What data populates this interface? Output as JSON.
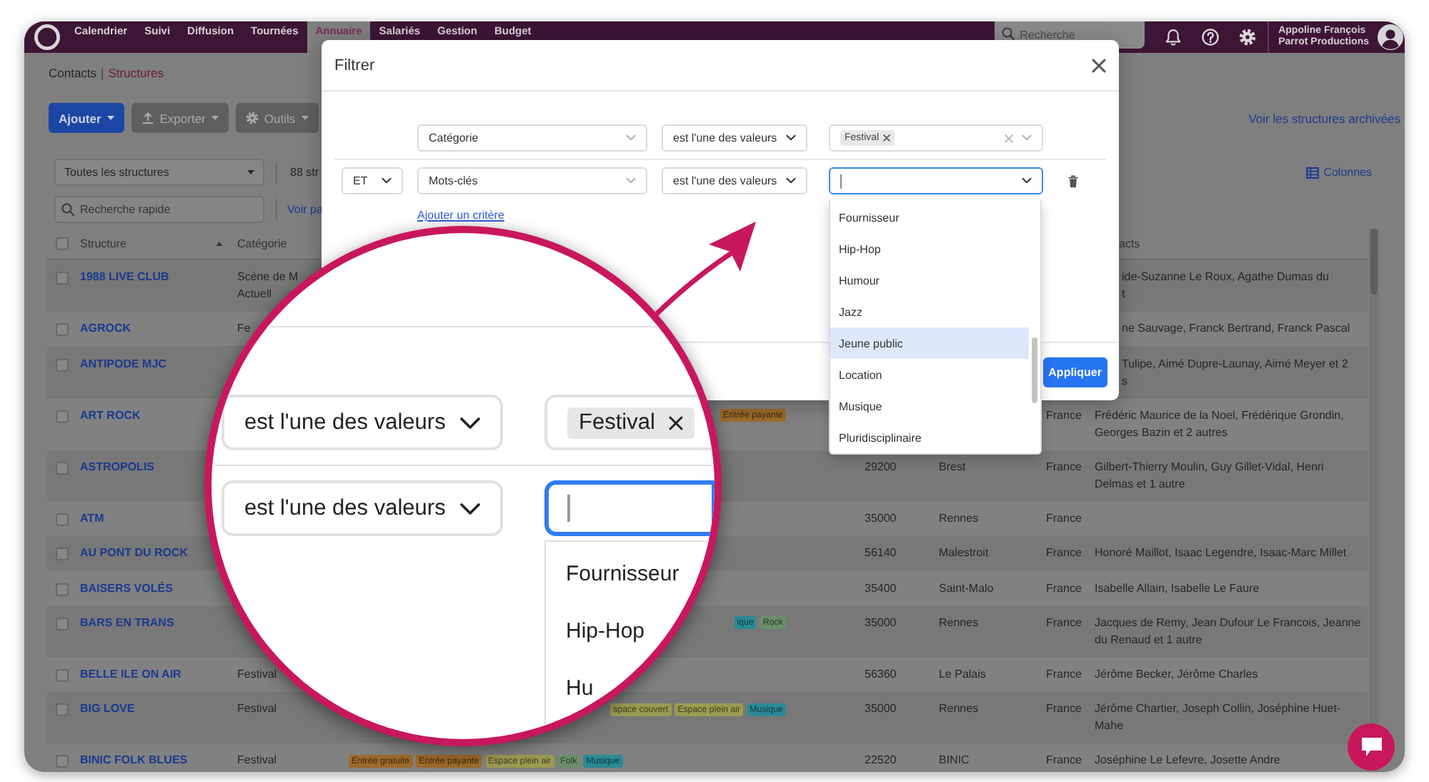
{
  "nav": {
    "items": [
      {
        "label": "Calendrier",
        "selected": false
      },
      {
        "label": "Suivi",
        "selected": false
      },
      {
        "label": "Diffusion",
        "selected": false
      },
      {
        "label": "Tournées",
        "selected": false
      },
      {
        "label": "Annuaire",
        "selected": true
      },
      {
        "label": "Salariés",
        "selected": false
      },
      {
        "label": "Gestion",
        "selected": false
      },
      {
        "label": "Budget",
        "selected": false
      }
    ],
    "search": {
      "placeholder": "Recherche"
    },
    "user": {
      "name": "Appoline François",
      "company": "Parrot Productions"
    }
  },
  "breadcrumb": {
    "parent": "Contacts",
    "separator": "|",
    "current": "Structures"
  },
  "toolbar": {
    "buttons": [
      {
        "label": "Ajouter",
        "kind": "primary"
      },
      {
        "label": "Exporter",
        "kind": "export"
      },
      {
        "label": "Outils",
        "kind": "tools"
      }
    ],
    "archived_link": "Voir les structures archivées"
  },
  "filters": {
    "scope": "Toutes les structures",
    "count": "88 str",
    "columns_link": "Colonnes",
    "quick_search": {
      "placeholder": "Recherche rapide"
    },
    "view_link": "Voir pa"
  },
  "table": {
    "select_all": {
      "checked": false
    },
    "columns": [
      {
        "label": "Structure",
        "sort_ascending": true
      },
      {
        "label": "Catégorie"
      },
      {
        "label": "acts"
      }
    ],
    "rows": [
      {
        "checked": false,
        "name": "1988 LIVE CLUB",
        "category": "Scène de M\nActuell",
        "contacts": "ide-Suzanne Le Roux, Agathe Dumas du\nt"
      },
      {
        "checked": false,
        "name": "AGROCK",
        "category": "Fe",
        "contacts": "ne Sauvage, Franck Bertrand, Franck Pascal"
      },
      {
        "checked": false,
        "name": "ANTIPODE MJC",
        "contacts": "Tulipe, Aimé Dupre-Launay, Aimé Meyer et 2\ns"
      },
      {
        "checked": false,
        "name": "ART ROCK",
        "tags": [
          {
            "label": "Entrée payante",
            "color": "#9c6a2a"
          }
        ],
        "country": "France",
        "contacts": "Frédéric Maurice de la Noel, Frédérique Grondin,\nGeorges Bazin et 2 autres"
      },
      {
        "checked": false,
        "name": "ASTROPOLIS",
        "code": "29200",
        "city": "Brest",
        "country": "France",
        "contacts": "Gilbert-Thierry Moulin, Guy Gillet-Vidal, Henri\nDelmas et 1 autre"
      },
      {
        "checked": false,
        "name": "ATM",
        "code": "35000",
        "city": "Rennes",
        "country": "France"
      },
      {
        "checked": false,
        "name": "AU PONT DU ROCK",
        "code": "56140",
        "city": "Malestroit",
        "country": "France",
        "contacts": "Honoré Maillot, Isaac Legendre, Isaac-Marc Millet"
      },
      {
        "checked": false,
        "name": "BAISERS VOLÉS",
        "code": "35400",
        "city": "Saint-Malo",
        "country": "France",
        "contacts": "Isabelle Allain, Isabelle Le Faure"
      },
      {
        "checked": false,
        "name": "BARS EN TRANS",
        "tags": [
          {
            "label": "ique",
            "color": "#2a8a96"
          },
          {
            "label": "Rock",
            "color": "#6a8f6a"
          }
        ],
        "code": "35000",
        "city": "Rennes",
        "country": "France",
        "contacts": "Jacques de Remy, Jean Dufour Le Francois, Jeanne\ndu Renaud et 1 autre"
      },
      {
        "checked": false,
        "name": "BELLE ILE ON AIR",
        "category": "Festival",
        "code": "56360",
        "city": "Le Palais",
        "country": "France",
        "contacts": "Jérôme Becker, Jérôme Charles"
      },
      {
        "checked": false,
        "name": "BIG LOVE",
        "category": "Festival",
        "tags": [
          {
            "label": "space couvert",
            "color": "#9c9a52"
          },
          {
            "label": "Espace plein air",
            "color": "#9c9a52"
          },
          {
            "label": "Musique",
            "color": "#2a8a96"
          }
        ],
        "code": "35000",
        "city": "Rennes",
        "country": "France",
        "contacts": "Jérôme Chartier, Joseph Collin, Joséphine Huet-\nMahe"
      },
      {
        "checked": false,
        "name": "BINIC FOLK BLUES",
        "category": "Festival",
        "tags": [
          {
            "label": "Entrée gratuite",
            "color": "#9c6a2a"
          },
          {
            "label": "Entrée payante",
            "color": "#9c6a2a"
          },
          {
            "label": "Espace plein air",
            "color": "#9c9a52"
          },
          {
            "label": "Folk",
            "color": "#6a8f6a"
          },
          {
            "label": "Musique",
            "color": "#2a8a96"
          }
        ],
        "code": "22520",
        "city": "BINIC",
        "country": "France",
        "contacts": "Joséphine Le Lefevre, Josette Andre"
      }
    ]
  },
  "modal": {
    "title": "Filtrer",
    "criteria": [
      {
        "field": "Catégorie",
        "operator": "est l'une des valeurs",
        "values": [
          "Festival"
        ],
        "focused": false
      },
      {
        "conjunction": "ET",
        "field": "Mots-clés",
        "operator": "est l'une des valeurs",
        "focused": true
      }
    ],
    "add_link": "Ajouter un critère",
    "apply_button": "Appliquer",
    "options": [
      {
        "label": "Fournisseur",
        "highlighted": false
      },
      {
        "label": "Hip-Hop",
        "highlighted": false
      },
      {
        "label": "Humour",
        "highlighted": false
      },
      {
        "label": "Jazz",
        "highlighted": false
      },
      {
        "label": "Jeune public",
        "highlighted": true
      },
      {
        "label": "Location",
        "highlighted": false
      },
      {
        "label": "Musique",
        "highlighted": false
      },
      {
        "label": "Pluridisciplinaire",
        "highlighted": false
      }
    ]
  },
  "magnifier": {
    "criteria": [
      {
        "operator": "est l'une des valeurs",
        "values": [
          "Festival"
        ],
        "focused": false
      },
      {
        "operator": "est l'une des valeurs",
        "focused": true
      }
    ],
    "options": [
      "Fournisseur",
      "Hip-Hop",
      "Hu"
    ]
  }
}
